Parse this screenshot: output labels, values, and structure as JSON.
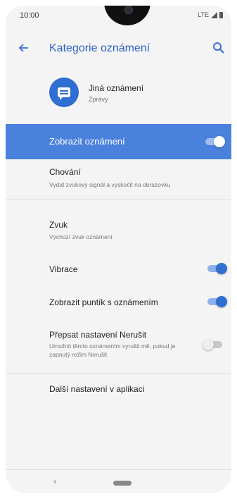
{
  "status_bar": {
    "time": "10:00",
    "network": "LTE"
  },
  "app_bar": {
    "title": "Kategorie oznámení",
    "back_icon": "arrow-back-icon",
    "search_icon": "search-icon"
  },
  "app_header": {
    "name": "Jiná oznámení",
    "subtitle": "Zprávy",
    "icon": "message-icon",
    "icon_color": "#2f6fd1"
  },
  "main_toggle": {
    "label": "Zobrazit oznámení",
    "on": true,
    "background": "#4a81dc"
  },
  "behavior": {
    "title": "Chování",
    "subtitle": "Vydat zvukový signál a vyskočit na obrazovku"
  },
  "sound": {
    "title": "Zvuk",
    "subtitle": "Výchozí zvuk oznámení"
  },
  "vibration": {
    "title": "Vibrace",
    "on": true
  },
  "badge": {
    "title": "Zobrazit puntík s oznámením",
    "on": true
  },
  "dnd": {
    "title": "Přepsat nastavení Nerušit",
    "subtitle": "Umožnit těmto oznámením vyrušit mě, pokud je zapnutý režim Nerušit",
    "on": false
  },
  "more": {
    "title": "Další nastavení v aplikaci"
  },
  "nav": {
    "back_glyph": "‹"
  },
  "colors": {
    "accent": "#2f6fd1",
    "title": "#2f63c9"
  }
}
